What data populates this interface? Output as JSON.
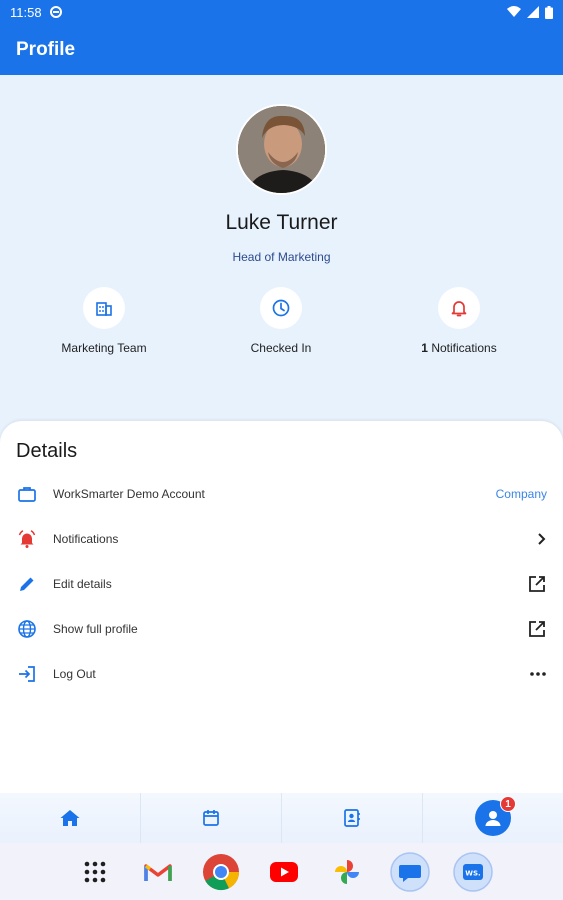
{
  "status_bar": {
    "time": "11:58"
  },
  "app_bar": {
    "title": "Profile"
  },
  "profile": {
    "name": "Luke Turner",
    "role": "Head of Marketing",
    "stats": [
      {
        "icon": "building-icon",
        "label": "Marketing Team"
      },
      {
        "icon": "clock-icon",
        "label": "Checked In"
      },
      {
        "icon": "bell-icon",
        "count": "1",
        "label": "Notifications"
      }
    ]
  },
  "details": {
    "title": "Details",
    "rows": [
      {
        "icon": "briefcase-icon",
        "label": "WorkSmarter Demo Account",
        "trailing": "Company"
      },
      {
        "icon": "alarm-bell-icon",
        "label": "Notifications",
        "trailing_icon": "chevron-right-icon"
      },
      {
        "icon": "pencil-icon",
        "label": "Edit details",
        "trailing_icon": "open-external-icon"
      },
      {
        "icon": "globe-icon",
        "label": "Show full profile",
        "trailing_icon": "open-external-icon"
      },
      {
        "icon": "logout-icon",
        "label": "Log Out",
        "trailing_icon": "more-horizontal-icon"
      }
    ]
  },
  "bottom_nav": {
    "items": [
      "home-icon",
      "calendar-icon",
      "contacts-icon",
      "profile-icon"
    ],
    "profile_badge": "1"
  },
  "dock": {
    "apps": [
      "app-grid-icon",
      "gmail-icon",
      "chrome-icon",
      "youtube-icon",
      "photos-icon",
      "messages-icon",
      "worksmarter-icon"
    ],
    "worksmarter_label": "WS."
  },
  "colors": {
    "primary": "#1a73e8",
    "alert": "#e53935",
    "link": "#3b86e6"
  }
}
